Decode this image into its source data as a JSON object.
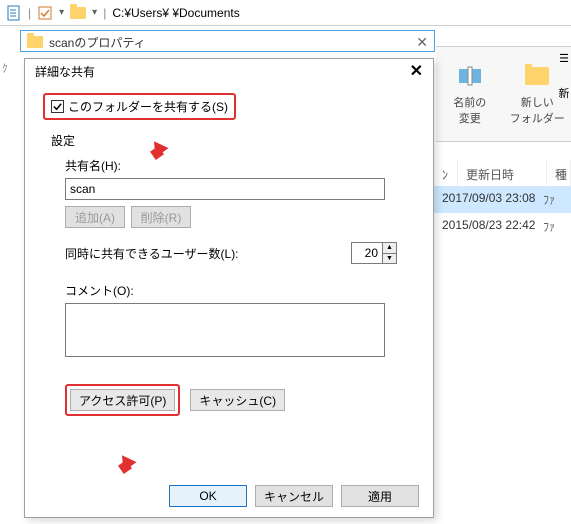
{
  "addr": {
    "path": "C:¥Users¥      ¥Documents"
  },
  "propwin": {
    "title": "scanのプロパティ"
  },
  "dlg": {
    "title": "詳細な共有",
    "share_checkbox": "このフォルダーを共有する(S)",
    "settings_label": "設定",
    "share_name_label": "共有名(H):",
    "share_name_value": "scan",
    "add_btn": "追加(A)",
    "remove_btn": "削除(R)",
    "users_label": "同時に共有できるユーザー数(L):",
    "users_value": "20",
    "comment_label": "コメント(O):",
    "comment_value": "",
    "perm_btn": "アクセス許可(P)",
    "cache_btn": "キャッシュ(C)",
    "ok": "OK",
    "cancel": "キャンセル",
    "apply": "適用"
  },
  "ribbon": {
    "rename": "名前の\n変更",
    "newfolder": "新しい\nフォルダー",
    "extra": "新"
  },
  "columns": {
    "icon": "ﾝﾄ",
    "date": "更新日時",
    "type": "種"
  },
  "files": [
    {
      "date": "2017/09/03 23:08",
      "type": "ﾌｧ"
    },
    {
      "date": "2015/08/23 22:42",
      "type": "ﾌｧ"
    }
  ],
  "leftg": "ｸ"
}
